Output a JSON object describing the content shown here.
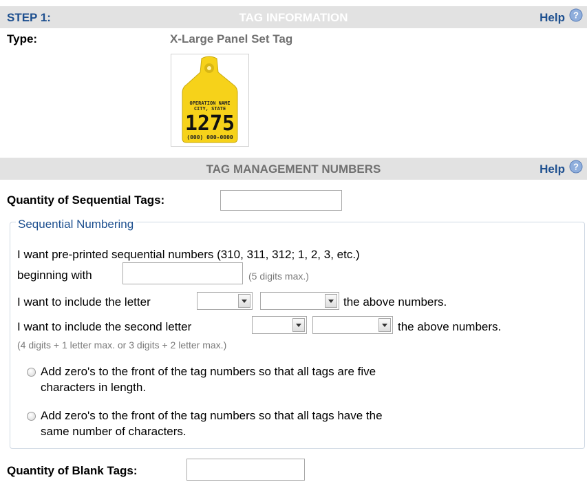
{
  "step": {
    "label": "STEP 1:",
    "title": "TAG INFORMATION",
    "help": "Help"
  },
  "type": {
    "label": "Type:",
    "value": "X-Large Panel Set Tag"
  },
  "tag_image": {
    "line1": "OPERATION NAME",
    "line2": "CITY, STATE",
    "number": "1275",
    "phone": "(000) 000-0000",
    "color": "#f6d21a"
  },
  "management": {
    "title": "TAG MANAGEMENT NUMBERS",
    "help": "Help"
  },
  "quantity_sequential": {
    "label": "Quantity of Sequential Tags:",
    "value": ""
  },
  "sequential": {
    "legend": "Sequential Numbering",
    "line1": "I want pre-printed sequential numbers (310, 311, 312; 1, 2, 3, etc.)",
    "beginning_label": "beginning with",
    "beginning_value": "",
    "beginning_hint": "(5 digits max.)",
    "letter_label": "I want to include the letter",
    "letter_suffix": "the above numbers.",
    "second_letter_label": "I want to include the second letter",
    "second_letter_suffix": "the above numbers.",
    "limit_hint": "(4 digits + 1 letter max. or 3 digits + 2 letter max.)",
    "option1_line1": "Add zero's to the front of the tag numbers so that all tags are five",
    "option1_line2": "characters in length.",
    "option2_line1": "Add zero's to the front of the tag numbers so that all tags have the",
    "option2_line2": "same number of characters."
  },
  "quantity_blank": {
    "label": "Quantity of Blank Tags:",
    "value": ""
  },
  "colors": {
    "accent": "#1d4f8f",
    "bar": "#e2e2e2",
    "muted": "#707070"
  }
}
